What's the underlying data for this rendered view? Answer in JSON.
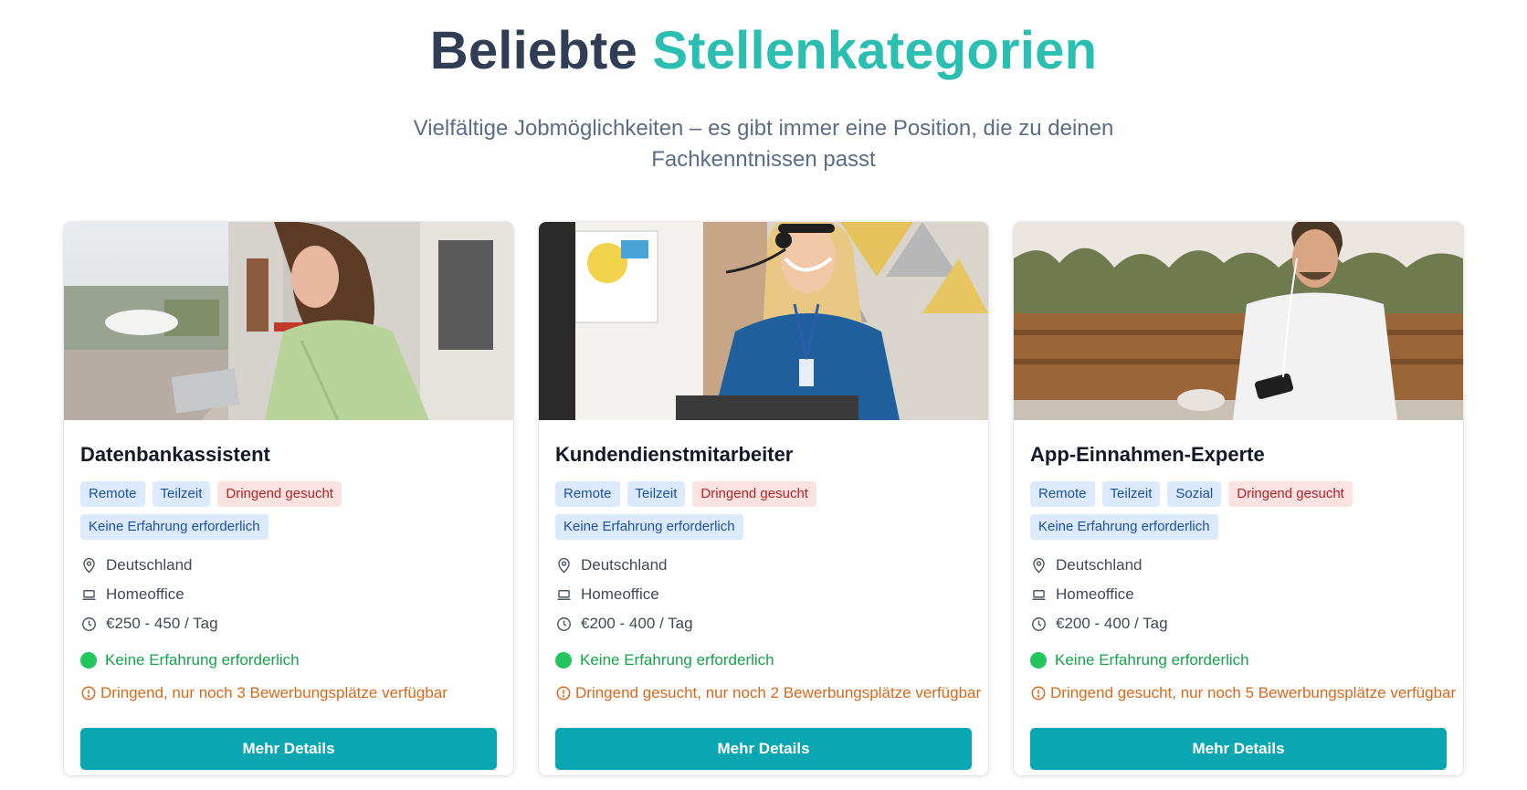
{
  "header": {
    "title_part1": "Beliebte",
    "title_part2": "Stellenkategorien",
    "subtitle": "Vielfältige Jobmöglichkeiten – es gibt immer eine Position, die zu deinen Fachkenntnissen passt"
  },
  "colors": {
    "title": "#2f3e54",
    "accent": "#2bbfb1",
    "button": "#0aa6b1",
    "tag_blue_bg": "#dbeafe",
    "tag_red_bg": "#fde2e2",
    "success": "#16a34a",
    "warning": "#d8691c"
  },
  "cards": [
    {
      "title": "Datenbankassistent",
      "image": "woman-typing-laptop-street-photo",
      "tags": [
        {
          "label": "Remote",
          "variant": "blue"
        },
        {
          "label": "Teilzeit",
          "variant": "blue"
        },
        {
          "label": "Dringend gesucht",
          "variant": "red"
        },
        {
          "label": "Keine Erfahrung erforderlich",
          "variant": "blue"
        }
      ],
      "location": "Deutschland",
      "work_mode": "Homeoffice",
      "salary": "€250 - 450 / Tag",
      "experience": "Keine Erfahrung erforderlich",
      "urgency": "Dringend, nur noch 3 Bewerbungsplätze verfügbar",
      "button": "Mehr Details"
    },
    {
      "title": "Kundendienstmitarbeiter",
      "image": "woman-headset-support-photo",
      "tags": [
        {
          "label": "Remote",
          "variant": "blue"
        },
        {
          "label": "Teilzeit",
          "variant": "blue"
        },
        {
          "label": "Dringend gesucht",
          "variant": "red"
        },
        {
          "label": "Keine Erfahrung erforderlich",
          "variant": "blue"
        }
      ],
      "location": "Deutschland",
      "work_mode": "Homeoffice",
      "salary": "€200 - 400 / Tag",
      "experience": "Keine Erfahrung erforderlich",
      "urgency": "Dringend gesucht, nur noch 2 Bewerbungsplätze verfügbar",
      "button": "Mehr Details"
    },
    {
      "title": "App-Einnahmen-Experte",
      "image": "man-earphones-phone-terrace-photo",
      "tags": [
        {
          "label": "Remote",
          "variant": "blue"
        },
        {
          "label": "Teilzeit",
          "variant": "blue"
        },
        {
          "label": "Sozial",
          "variant": "blue"
        },
        {
          "label": "Dringend gesucht",
          "variant": "red"
        },
        {
          "label": "Keine Erfahrung erforderlich",
          "variant": "blue"
        }
      ],
      "location": "Deutschland",
      "work_mode": "Homeoffice",
      "salary": "€200 - 400 / Tag",
      "experience": "Keine Erfahrung erforderlich",
      "urgency": "Dringend gesucht, nur noch 5 Bewerbungsplätze verfügbar",
      "button": "Mehr Details"
    }
  ]
}
